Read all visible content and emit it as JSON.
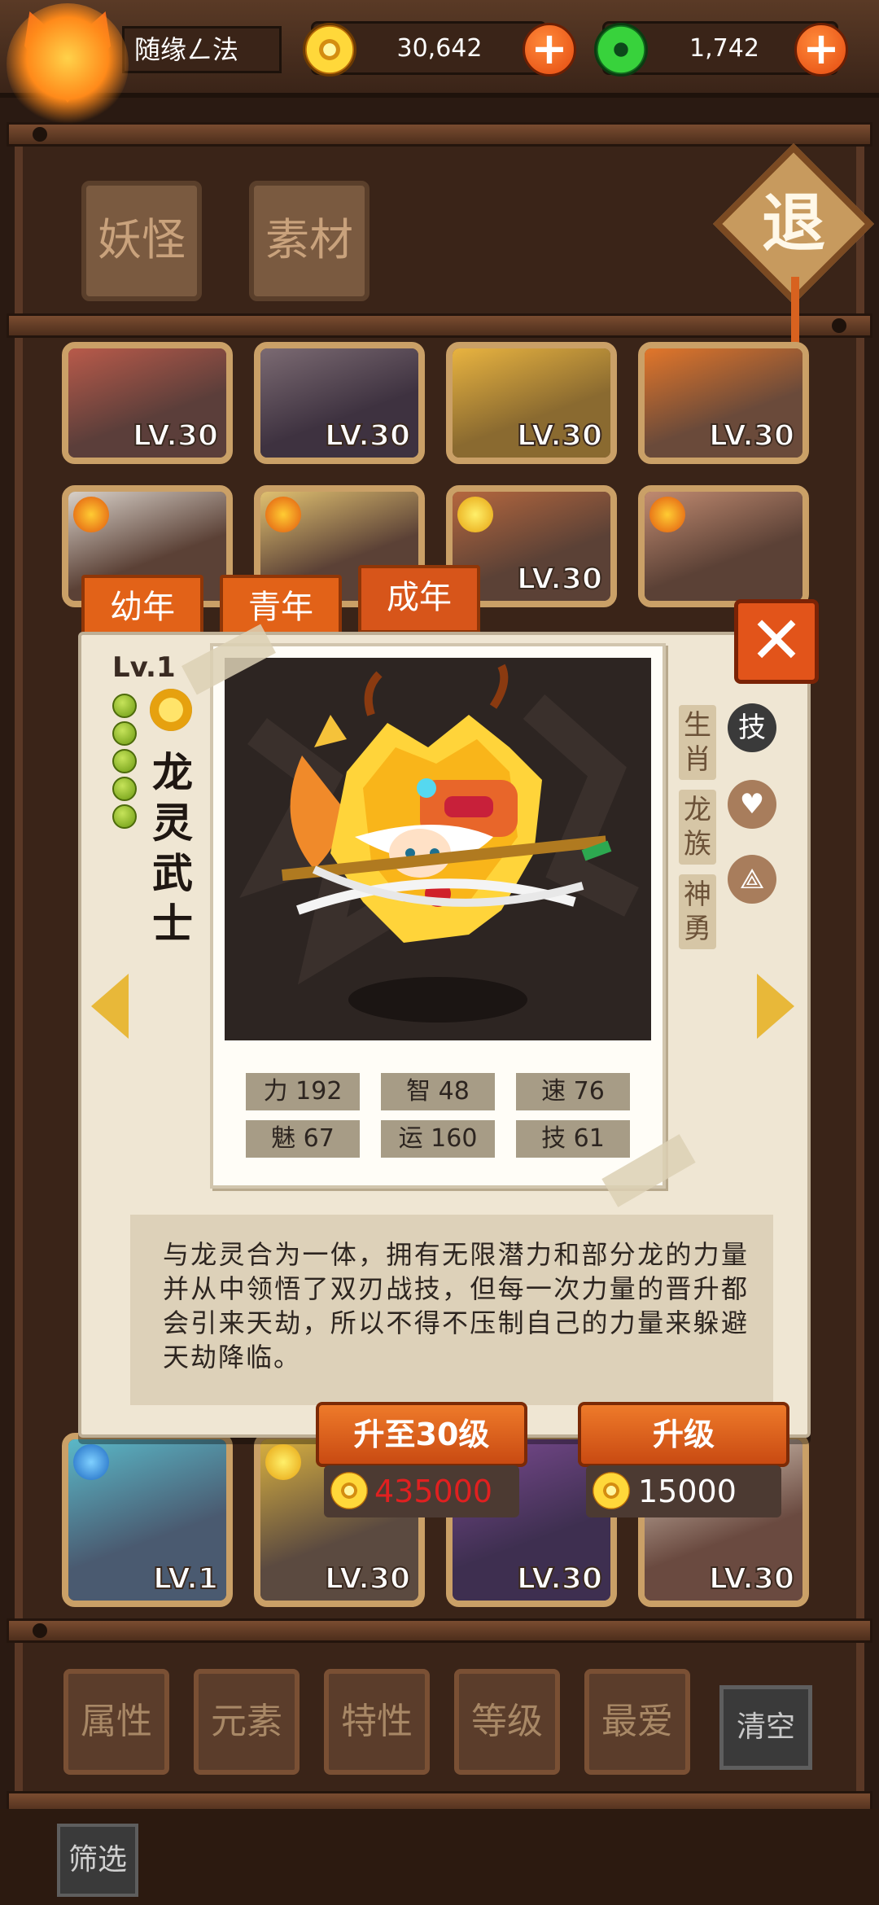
{
  "player": {
    "name": "随缘ㄥ法",
    "avatar_icon": "fox-mask-icon"
  },
  "currency": {
    "gold": {
      "value": "30,642",
      "icon": "gold-coin-icon",
      "add_label": "+"
    },
    "jade": {
      "value": "1,742",
      "icon": "jade-coin-icon",
      "add_label": "+"
    }
  },
  "categories": {
    "yokai_label": "妖怪",
    "material_label": "素材"
  },
  "retreat_label": "退",
  "grid": {
    "top_row_lv": [
      "LV.30",
      "LV.30",
      "LV.30",
      "LV.30"
    ],
    "second_row_lv": [
      "",
      "",
      "LV.30",
      ""
    ],
    "bottom_row_lv": [
      "LV.1",
      "LV.30",
      "LV.30",
      "LV.30"
    ]
  },
  "age_tabs": [
    {
      "label": "幼年",
      "active": false
    },
    {
      "label": "青年",
      "active": false
    },
    {
      "label": "成年",
      "active": true
    }
  ],
  "detail": {
    "level": "Lv.1",
    "name": "龙灵武士",
    "traits": [
      "生肖",
      "龙族",
      "神勇"
    ],
    "skill_label": "技",
    "icons": {
      "skill": "skill-icon",
      "favorite": "heart-icon",
      "share": "share-icon",
      "element": "sun-element-icon"
    },
    "stats": [
      {
        "label": "力",
        "value": "192"
      },
      {
        "label": "智",
        "value": "48"
      },
      {
        "label": "速",
        "value": "76"
      },
      {
        "label": "魅",
        "value": "67"
      },
      {
        "label": "运",
        "value": "160"
      },
      {
        "label": "技",
        "value": "61"
      }
    ],
    "description": "与龙灵合为一体，拥有无限潜力和部分龙的力量并从中领悟了双刃战技，但每一次力量的晋升都会引来天劫，所以不得不压制自己的力量来躲避天劫降临。",
    "close_label": "✕"
  },
  "upgrade": {
    "to30": {
      "label": "升至30级",
      "cost": "435000",
      "cost_color": "#e02020"
    },
    "one": {
      "label": "升级",
      "cost": "15000",
      "cost_color": "#ffffff"
    }
  },
  "filters": [
    "属性",
    "元素",
    "特性",
    "等级",
    "最爱"
  ],
  "clear_label": "清空",
  "filter_button_label": "筛选"
}
